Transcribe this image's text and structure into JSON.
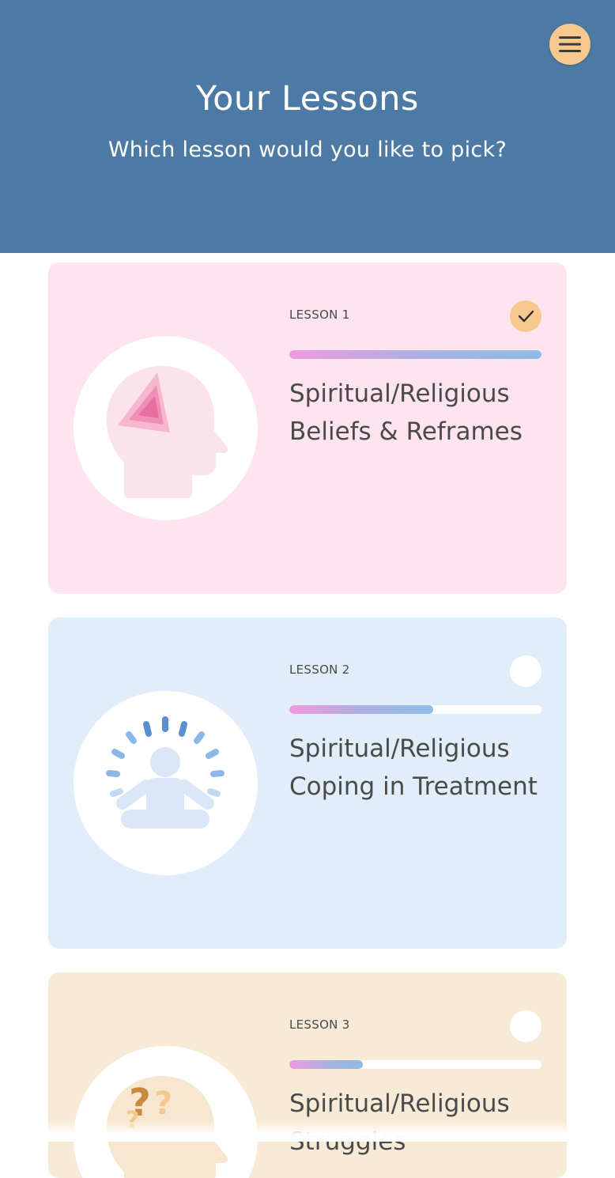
{
  "header": {
    "title": "Your Lessons",
    "subtitle": "Which lesson would you like to pick?",
    "menu_icon": "hamburger-menu-icon"
  },
  "colors": {
    "header_bg": "#4d7aa4",
    "menu_button": "#f8c98e",
    "card_pink": "#fde4ef",
    "card_blue": "#e2edfa",
    "card_peach": "#f7ebd7"
  },
  "lessons": [
    {
      "label": "LESSON 1",
      "title": "Spiritual/Religious Beliefs & Reframes",
      "progress": 1.0,
      "completed": true,
      "status_icon": "checkmark-icon",
      "illustration": "head-with-triangle-icon"
    },
    {
      "label": "LESSON 2",
      "title": "Spiritual/Religious Coping in Treatment",
      "progress": 0.57,
      "completed": false,
      "status_icon": "empty-circle-icon",
      "illustration": "meditating-person-icon"
    },
    {
      "label": "LESSON 3",
      "title": "Spiritual/Religious Struggles",
      "progress": 0.29,
      "completed": false,
      "status_icon": "empty-circle-icon",
      "illustration": "head-with-question-marks-icon"
    }
  ]
}
